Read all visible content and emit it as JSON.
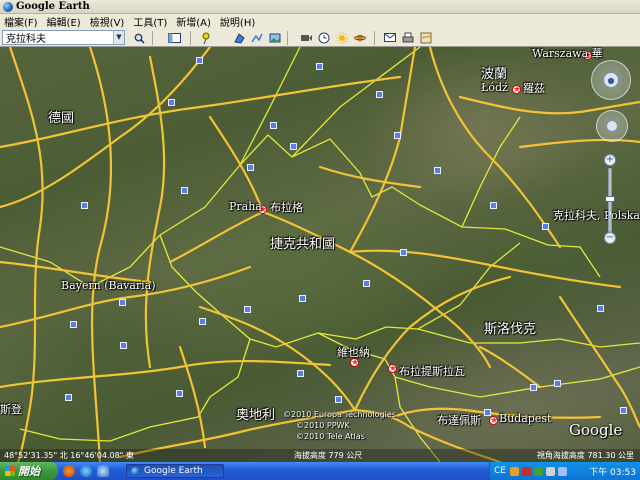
{
  "window": {
    "title": "Google Earth"
  },
  "menu": {
    "items": [
      "檔案(F)",
      "編輯(E)",
      "檢視(V)",
      "工具(T)",
      "新增(A)",
      "說明(H)"
    ]
  },
  "search": {
    "value": "克拉科夫"
  },
  "toolbar": {
    "buttons": [
      "search-go",
      "sidebar-toggle",
      "placemark",
      "polygon",
      "path",
      "image-overlay",
      "record-tour",
      "historical-imagery",
      "sunlight",
      "planets",
      "email",
      "print",
      "view-in-maps"
    ]
  },
  "map": {
    "places": [
      {
        "id": "warszawa",
        "text": "Warszawa 華",
        "size": "normal"
      },
      {
        "id": "poland",
        "text": "波蘭",
        "size": "big"
      },
      {
        "id": "lodz",
        "text": "Łódź",
        "size": "normal"
      },
      {
        "id": "lodz-cn",
        "text": "羅茲",
        "size": "normal"
      },
      {
        "id": "germany",
        "text": "德國",
        "size": "big"
      },
      {
        "id": "praha",
        "text": "Praha",
        "size": "normal"
      },
      {
        "id": "praha-cn",
        "text": "布拉格",
        "size": "normal"
      },
      {
        "id": "czech",
        "text": "捷克共和國",
        "size": "big"
      },
      {
        "id": "krakow",
        "text": "克拉科夫, Polska",
        "size": "normal"
      },
      {
        "id": "bayern",
        "text": "Bayern (Bavaria)",
        "size": "normal"
      },
      {
        "id": "slovakia",
        "text": "斯洛伐克",
        "size": "big"
      },
      {
        "id": "vienna",
        "text": "維也納",
        "size": "normal"
      },
      {
        "id": "bratislava",
        "text": "布拉提斯拉瓦",
        "size": "normal"
      },
      {
        "id": "austria",
        "text": "奧地利",
        "size": "big"
      },
      {
        "id": "budapest-cn",
        "text": "布達佩斯",
        "size": "normal"
      },
      {
        "id": "budapest",
        "text": "Budapest",
        "size": "normal"
      },
      {
        "id": "left-edge",
        "text": "斯登",
        "size": "normal"
      }
    ]
  },
  "credits": {
    "line1": "©2010 Europa Technologies",
    "line2": "©2010 PPWK",
    "line3": "©2010 Tele Atlas",
    "google": "Google"
  },
  "status": {
    "coords": "48°52'31.35\" 北    16°46'04.08\" 東",
    "elevation": "海拔高度   779 公尺",
    "eye_alt": "視角海拔高度  781.30 公里"
  },
  "taskbar": {
    "start": "開始",
    "task_ge": "Google Earth",
    "ime": "CE",
    "clock": "下午 03:53"
  },
  "colors": {
    "road": "#f2c335",
    "border": "#e2ea3a",
    "pano": "#5a7dea",
    "taskbar": "#245edb"
  }
}
